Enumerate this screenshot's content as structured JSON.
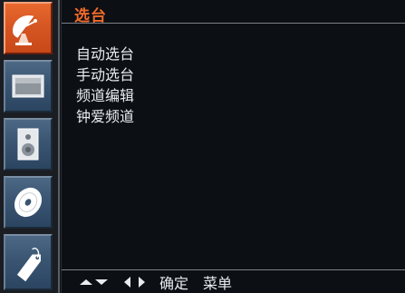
{
  "sidebar": {
    "items": [
      {
        "icon": "satellite-dish-icon",
        "selected": true
      },
      {
        "icon": "picture-icon",
        "selected": false
      },
      {
        "icon": "speaker-icon",
        "selected": false
      },
      {
        "icon": "disc-icon",
        "selected": false
      },
      {
        "icon": "tag-icon",
        "selected": false
      }
    ]
  },
  "header": {
    "title": "选台"
  },
  "menu": {
    "items": [
      "自动选台",
      "手动选台",
      "频道编辑",
      "钟爱频道"
    ]
  },
  "footer": {
    "nav_up_down_icon": "up-down-arrows-icon",
    "nav_left_right_icon": "left-right-arrows-icon",
    "confirm_label": "确定",
    "menu_label": "菜单"
  },
  "colors": {
    "accent": "#f26a2a",
    "selected_tab": "#d55522",
    "tab": "#3a5572",
    "background": "#0c0f13",
    "text": "#e8ebef"
  }
}
